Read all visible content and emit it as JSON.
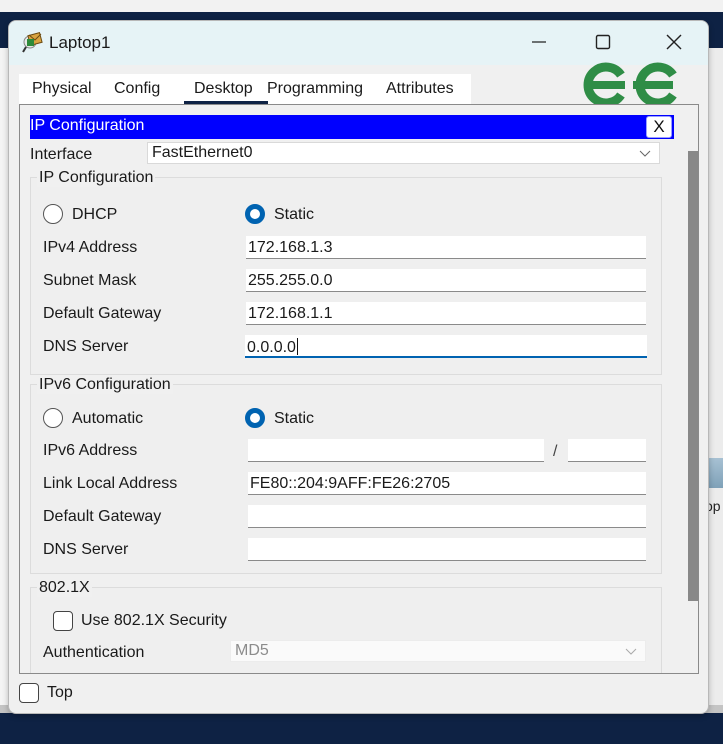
{
  "window": {
    "title": "Laptop1",
    "controls": {
      "minimize": "minimize",
      "maximize": "maximize",
      "close": "close"
    }
  },
  "tabs": [
    {
      "label": "Physical",
      "active": false
    },
    {
      "label": "Config",
      "active": false
    },
    {
      "label": "Desktop",
      "active": true
    },
    {
      "label": "Programming",
      "active": false
    },
    {
      "label": "Attributes",
      "active": false
    }
  ],
  "watermark": {
    "text": "GfG",
    "color": "#2f8d46"
  },
  "panel": {
    "title": "IP Configuration",
    "close_label": "X",
    "header_color": "#0000ff",
    "interface": {
      "label": "Interface",
      "value": "FastEthernet0"
    },
    "ipv4": {
      "group_title": "IP Configuration",
      "mode_options": [
        {
          "label": "DHCP",
          "selected": false
        },
        {
          "label": "Static",
          "selected": true
        }
      ],
      "fields": [
        {
          "label": "IPv4 Address",
          "value": "172.168.1.3"
        },
        {
          "label": "Subnet Mask",
          "value": "255.255.0.0"
        },
        {
          "label": "Default Gateway",
          "value": "172.168.1.1"
        },
        {
          "label": "DNS Server",
          "value": "0.0.0.0",
          "focused": true
        }
      ]
    },
    "ipv6": {
      "group_title": "IPv6 Configuration",
      "mode_options": [
        {
          "label": "Automatic",
          "selected": false
        },
        {
          "label": "Static",
          "selected": true
        }
      ],
      "address": {
        "label": "IPv6 Address",
        "value": "",
        "prefix_separator": "/",
        "prefix_value": ""
      },
      "fields": [
        {
          "label": "Link Local Address",
          "value": "FE80::204:9AFF:FE26:2705"
        },
        {
          "label": "Default Gateway",
          "value": ""
        },
        {
          "label": "DNS Server",
          "value": ""
        }
      ]
    },
    "dot1x": {
      "group_title": "802.1X",
      "use_security": {
        "label": "Use 802.1X Security",
        "checked": false
      },
      "authentication": {
        "label": "Authentication",
        "value": "MD5",
        "disabled": true
      }
    }
  },
  "footer": {
    "top_checkbox": {
      "label": "Top",
      "checked": false
    }
  },
  "background": {
    "partial_label": "op"
  },
  "colors": {
    "accent": "#0063b1",
    "titlebar": "#e6f3f6",
    "desktop_band": "#0e2244"
  }
}
